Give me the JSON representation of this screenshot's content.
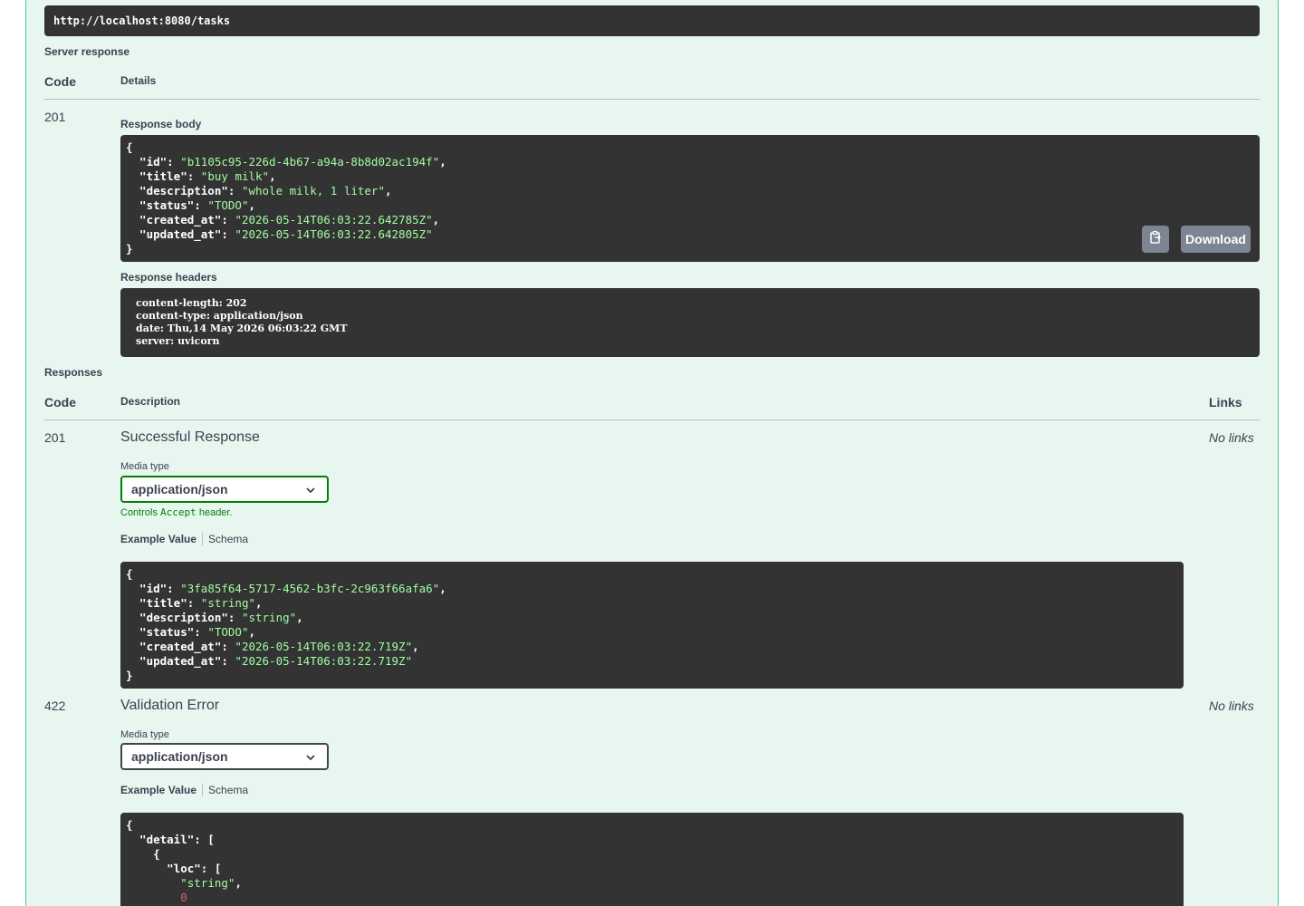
{
  "request_url": "http://localhost:8080/tasks",
  "server_response": {
    "heading": "Server response",
    "col_code": "Code",
    "col_details": "Details",
    "code": "201",
    "body_heading": "Response body",
    "body_lines": [
      [
        {
          "t": "{"
        }
      ],
      [
        {
          "t": "  \"id\": "
        },
        {
          "s": "\"b1105c95-226d-4b67-a94a-8b8d02ac194f\""
        },
        {
          "t": ","
        }
      ],
      [
        {
          "t": "  \"title\": "
        },
        {
          "s": "\"buy milk\""
        },
        {
          "t": ","
        }
      ],
      [
        {
          "t": "  \"description\": "
        },
        {
          "s": "\"whole milk, 1 liter\""
        },
        {
          "t": ","
        }
      ],
      [
        {
          "t": "  \"status\": "
        },
        {
          "s": "\"TODO\""
        },
        {
          "t": ","
        }
      ],
      [
        {
          "t": "  \"created_at\": "
        },
        {
          "s": "\"2026-05-14T06:03:22.642785Z\""
        },
        {
          "t": ","
        }
      ],
      [
        {
          "t": "  \"updated_at\": "
        },
        {
          "s": "\"2026-05-14T06:03:22.642805Z\""
        }
      ],
      [
        {
          "t": "}"
        }
      ]
    ],
    "download_label": "Download",
    "headers_heading": "Response headers",
    "headers": [
      "content-length: 202",
      "content-type: application/json",
      "date: Thu,14 May 2026 06:03:22 GMT",
      "server: uvicorn"
    ]
  },
  "responses": {
    "heading": "Responses",
    "col_code": "Code",
    "col_description": "Description",
    "col_links": "Links",
    "items": [
      {
        "code": "201",
        "description": "Successful Response",
        "links": "No links",
        "media_label": "Media type",
        "media_value": "application/json",
        "controls_prefix": "Controls ",
        "controls_code": "Accept",
        "controls_suffix": " header.",
        "tab_example": "Example Value",
        "tab_schema": "Schema",
        "example_lines": [
          [
            {
              "t": "{"
            }
          ],
          [
            {
              "t": "  \"id\": "
            },
            {
              "s": "\"3fa85f64-5717-4562-b3fc-2c963f66afa6\""
            },
            {
              "t": ","
            }
          ],
          [
            {
              "t": "  \"title\": "
            },
            {
              "s": "\"string\""
            },
            {
              "t": ","
            }
          ],
          [
            {
              "t": "  \"description\": "
            },
            {
              "s": "\"string\""
            },
            {
              "t": ","
            }
          ],
          [
            {
              "t": "  \"status\": "
            },
            {
              "s": "\"TODO\""
            },
            {
              "t": ","
            }
          ],
          [
            {
              "t": "  \"created_at\": "
            },
            {
              "s": "\"2026-05-14T06:03:22.719Z\""
            },
            {
              "t": ","
            }
          ],
          [
            {
              "t": "  \"updated_at\": "
            },
            {
              "s": "\"2026-05-14T06:03:22.719Z\""
            }
          ],
          [
            {
              "t": "}"
            }
          ]
        ]
      },
      {
        "code": "422",
        "description": "Validation Error",
        "links": "No links",
        "media_label": "Media type",
        "media_value": "application/json",
        "tab_example": "Example Value",
        "tab_schema": "Schema",
        "example_lines": [
          [
            {
              "t": "{"
            }
          ],
          [
            {
              "t": "  \"detail\": ["
            }
          ],
          [
            {
              "t": "    {"
            }
          ],
          [
            {
              "t": "      \"loc\": ["
            }
          ],
          [
            {
              "t": "        "
            },
            {
              "s": "\"string\""
            },
            {
              "t": ","
            }
          ],
          [
            {
              "t": "        "
            },
            {
              "n": "0"
            }
          ]
        ]
      }
    ]
  },
  "icons": {
    "copy": "clipboard-icon",
    "dropdown": "chevron-down-icon"
  },
  "colors": {
    "block_bg": "#e8f6f0",
    "block_border": "#49cc90",
    "code_bg": "#333333",
    "string": "#a2fca2",
    "number": "#d36363",
    "button": "#7d8492",
    "select_border_active": "#008000"
  }
}
